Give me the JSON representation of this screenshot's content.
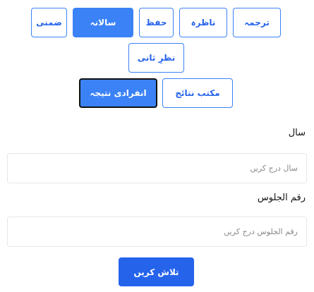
{
  "tabs": {
    "row1": [
      "ترجمہ",
      "ناظرہ",
      "حفظ",
      "سالانہ",
      "ضمنی"
    ],
    "row2": [
      "نظرِ ثانی"
    ],
    "row3": [
      "مکتب نتائج",
      "انفرادی نتیجہ"
    ]
  },
  "form": {
    "year_label": "سال",
    "year_placeholder": "سال درج کریں",
    "roll_label": "رقم الجلوس",
    "roll_placeholder": "رقم الجلوس درج کریں"
  },
  "search_label": "تلاش کریں"
}
